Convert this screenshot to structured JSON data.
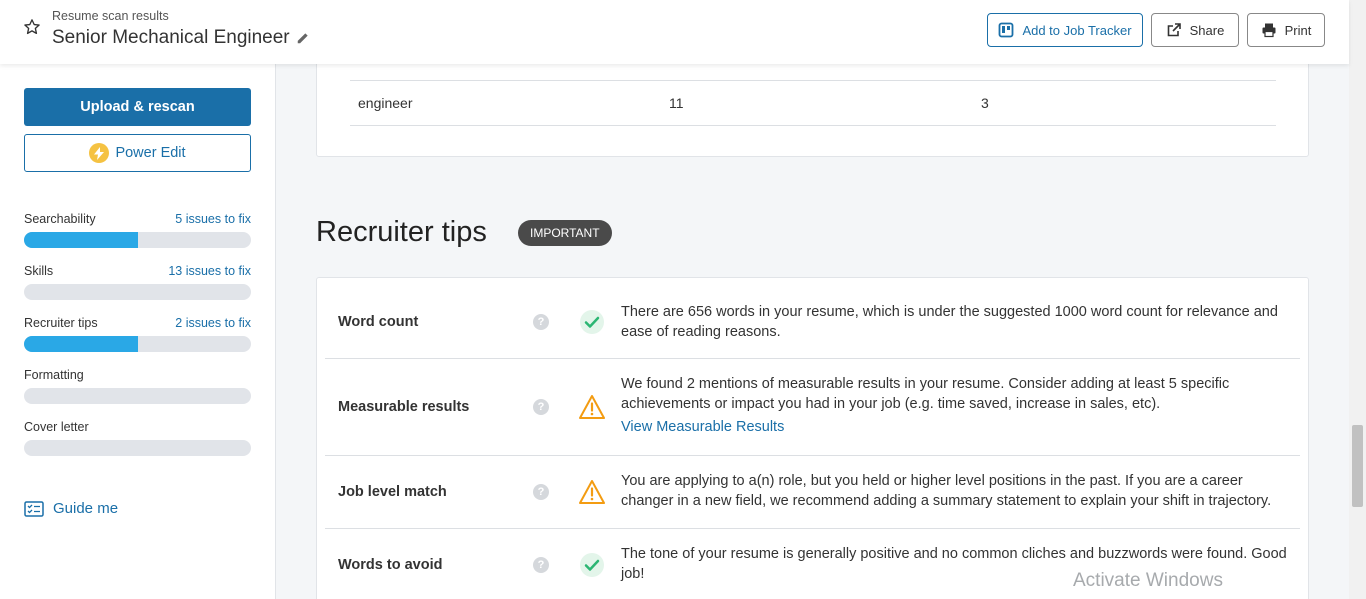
{
  "header": {
    "subtitle": "Resume scan results",
    "title": "Senior Mechanical Engineer",
    "tracker_label": "Add to Job Tracker",
    "share_label": "Share",
    "print_label": "Print"
  },
  "sidebar": {
    "upload_label": "Upload & rescan",
    "power_edit_label": "Power Edit",
    "categories": [
      {
        "name": "Searchability",
        "issues": "5 issues to fix",
        "progress": 0.5
      },
      {
        "name": "Skills",
        "issues": "13 issues to fix",
        "progress": 0
      },
      {
        "name": "Recruiter tips",
        "issues": "2 issues to fix",
        "progress": 0.5
      },
      {
        "name": "Formatting",
        "issues": "",
        "progress": 0
      },
      {
        "name": "Cover letter",
        "issues": "",
        "progress": 0
      }
    ],
    "guide_label": "Guide me"
  },
  "keywords": {
    "row": {
      "term": "engineer",
      "resume_count": "11",
      "job_count": "3"
    }
  },
  "recruiter_tips": {
    "heading": "Recruiter tips",
    "badge": "IMPORTANT",
    "tips": [
      {
        "title": "Word count",
        "status": "pass",
        "text": "There are 656 words in your resume, which is under the suggested 1000 word count for relevance and ease of reading reasons.",
        "link": ""
      },
      {
        "title": "Measurable results",
        "status": "warning",
        "text": "We found 2 mentions of measurable results in your resume. Consider adding at least 5 specific achievements or impact you had in your job (e.g. time saved, increase in sales, etc).",
        "link": "View Measurable Results"
      },
      {
        "title": "Job level match",
        "status": "warning",
        "text": "You are applying to a(n) role, but you held or higher level positions in the past. If you are a career changer in a new field, we recommend adding a summary statement to explain your shift in trajectory.",
        "link": ""
      },
      {
        "title": "Words to avoid",
        "status": "pass",
        "text": "The tone of your resume is generally positive and no common cliches and buzzwords were found. Good job!",
        "link": ""
      }
    ]
  },
  "watermark": "Activate Windows",
  "colors": {
    "accent": "#1a6fa8",
    "progress": "#2aa8e6",
    "pass": "#2bb673",
    "warning": "#f39c12"
  }
}
